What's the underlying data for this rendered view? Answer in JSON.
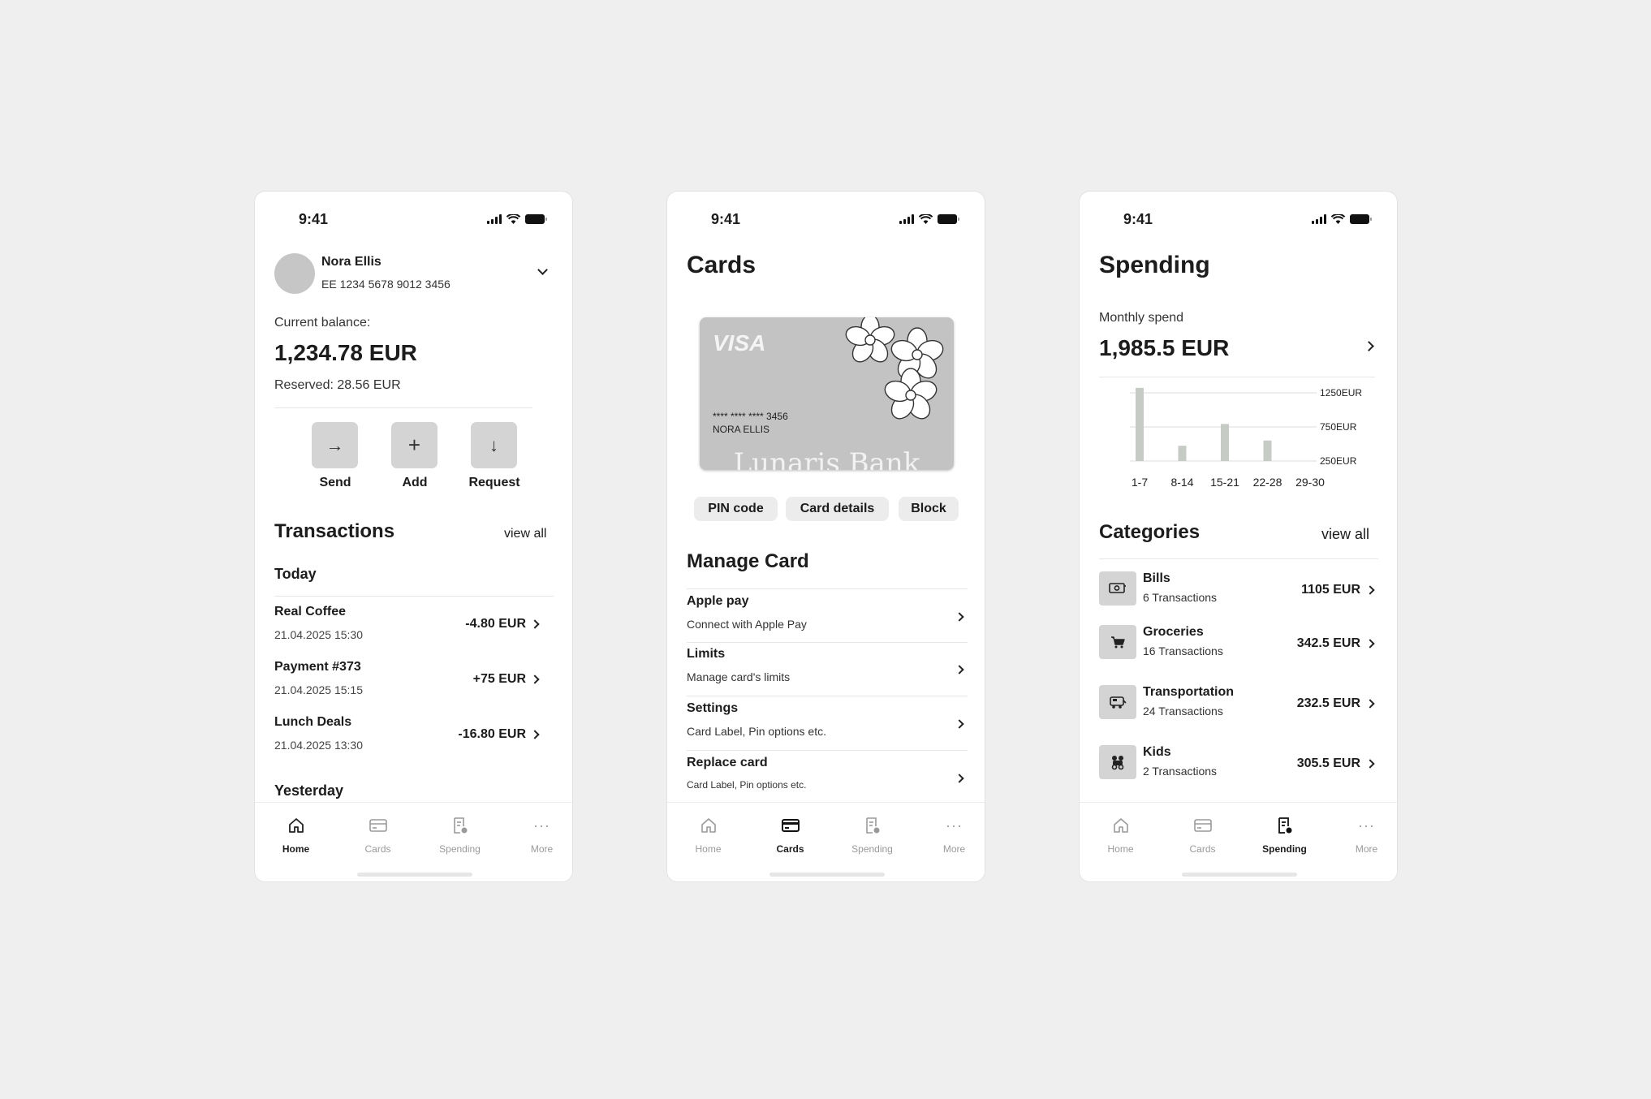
{
  "status_time": "9:41",
  "nav": [
    {
      "label": "Home",
      "icon": "home-icon"
    },
    {
      "label": "Cards",
      "icon": "card-icon"
    },
    {
      "label": "Spending",
      "icon": "receipt-icon"
    },
    {
      "label": "More",
      "icon": "more-icon"
    }
  ],
  "home": {
    "user_name": "Nora Ellis",
    "iban": "EE 1234 5678 9012 3456",
    "balance_label": "Current balance:",
    "balance": "1,234.78 EUR",
    "reserved": "Reserved: 28.56 EUR",
    "actions": [
      {
        "label": "Send",
        "icon": "arrow-right-icon"
      },
      {
        "label": "Add",
        "icon": "plus-icon"
      },
      {
        "label": "Request",
        "icon": "arrow-down-icon"
      }
    ],
    "transactions_title": "Transactions",
    "view_all": "view all",
    "today": "Today",
    "transactions": [
      {
        "title": "Real Coffee",
        "date": "21.04.2025 15:30",
        "amount": "-4.80 EUR"
      },
      {
        "title": "Payment #373",
        "date": "21.04.2025 15:15",
        "amount": "+75 EUR"
      },
      {
        "title": "Lunch Deals",
        "date": "21.04.2025 13:30",
        "amount": "-16.80 EUR"
      }
    ],
    "yesterday": "Yesterday"
  },
  "cards": {
    "title": "Cards",
    "card_brand": "VISA",
    "card_number": "**** **** **** 3456",
    "card_holder": "NORA ELLIS",
    "bank_name": "Lunaris Bank",
    "buttons": [
      "PIN code",
      "Card details",
      "Block"
    ],
    "manage_title": "Manage Card",
    "rows": [
      {
        "title": "Apple pay",
        "sub": "Connect with Apple Pay"
      },
      {
        "title": "Limits",
        "sub": "Manage card's limits"
      },
      {
        "title": "Settings",
        "sub": "Card Label, Pin options etc."
      },
      {
        "title": "Replace card",
        "sub": "Card Label, Pin options etc."
      }
    ]
  },
  "spending": {
    "title": "Spending",
    "monthly_label": "Monthly spend",
    "monthly_value": "1,985.5 EUR",
    "categories_title": "Categories",
    "view_all": "view all",
    "categories": [
      {
        "title": "Bills",
        "sub": "6 Transactions",
        "amount": "1105 EUR",
        "icon": "bill-icon"
      },
      {
        "title": "Groceries",
        "sub": "16 Transactions",
        "amount": "342.5 EUR",
        "icon": "cart-icon"
      },
      {
        "title": "Transportation",
        "sub": "24 Transactions",
        "amount": "232.5 EUR",
        "icon": "bus-icon"
      },
      {
        "title": "Kids",
        "sub": "2 Transactions",
        "amount": "305.5 EUR",
        "icon": "kids-icon"
      }
    ]
  },
  "chart_data": {
    "type": "bar",
    "categories": [
      "1-7",
      "8-14",
      "15-21",
      "22-28",
      "29-30"
    ],
    "values": [
      1105,
      230,
      560,
      310,
      0
    ],
    "ytick_labels": [
      "1250EUR",
      "750EUR",
      "250EUR"
    ],
    "yticks": [
      1250,
      750,
      250
    ],
    "ylim": [
      0,
      1250
    ],
    "grid": true,
    "bar_color": "#c6cbc6"
  }
}
